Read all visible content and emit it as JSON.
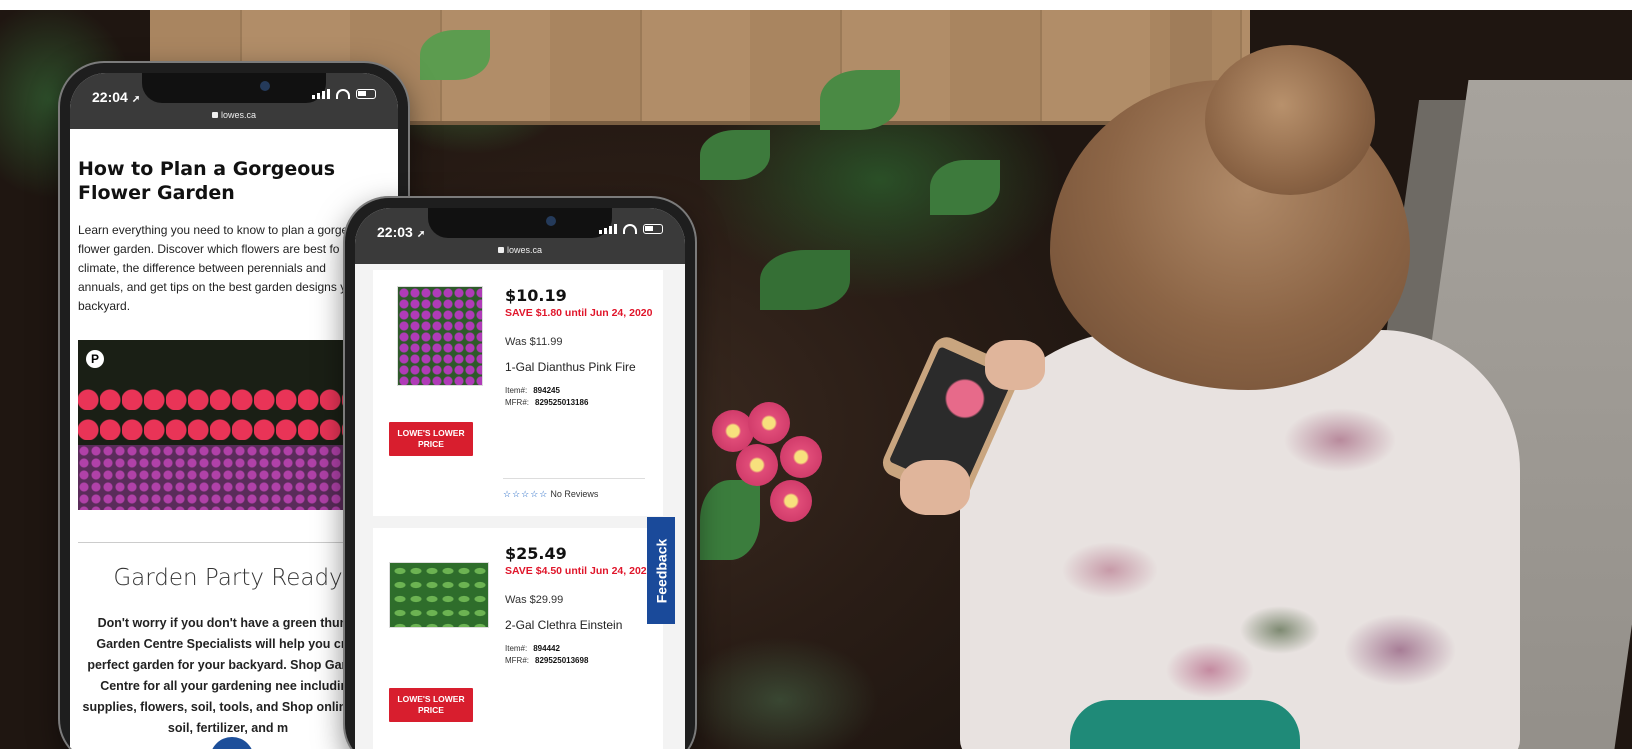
{
  "phone_article": {
    "status": {
      "time": "22:04",
      "url": "lowes.ca"
    },
    "title": "How to Plan a Gorgeous Flower Garden",
    "intro": "Learn everything you need to know to plan a gorge flower garden. Discover which flowers are best fo climate, the difference between perennials and annuals, and get tips on the best garden designs your backyard.",
    "image_badge": "P",
    "section_title": "Garden Party Ready",
    "section_body": "Don't worry if you don't have a green thumb Garden Centre Specialists will help you crea perfect garden for your backyard. Shop Garden Centre for all your gardening nee including supplies, flowers, soil, tools, and Shop online for soil, fertilizer, and m"
  },
  "phone_products": {
    "status": {
      "time": "22:03",
      "url": "lowes.ca"
    },
    "products": [
      {
        "price": "$10.19",
        "save": "SAVE $1.80 until Jun 24, 2020",
        "was": "Was $11.99",
        "name": "1-Gal Dianthus Pink Fire",
        "item_label": "Item#:",
        "item": "894245",
        "mfr_label": "MFR#:",
        "mfr": "829525013186",
        "badge": "LOWE'S LOWER PRICE",
        "stars": "☆☆☆☆☆",
        "reviews": "No Reviews"
      },
      {
        "price": "$25.49",
        "save": "SAVE $4.50 until Jun 24, 2020",
        "was": "Was $29.99",
        "name": "2-Gal Clethra Einstein",
        "item_label": "Item#:",
        "item": "894442",
        "mfr_label": "MFR#:",
        "mfr": "829525013698",
        "badge": "LOWE'S LOWER PRICE"
      }
    ],
    "feedback_label": "Feedback"
  },
  "colors": {
    "accent_red": "#d81e2e",
    "link_blue": "#1a4a9a"
  }
}
